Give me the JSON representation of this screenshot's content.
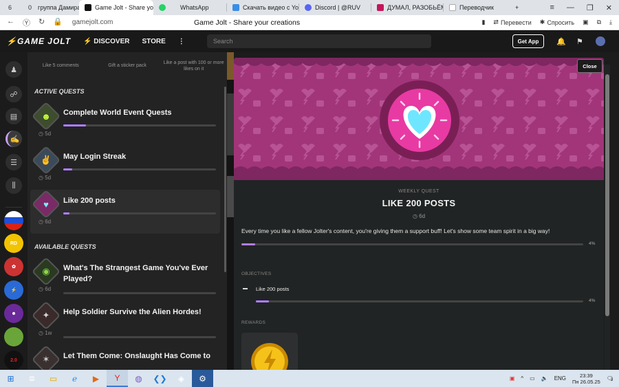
{
  "browser": {
    "tabs": [
      {
        "label": "6",
        "kind": "counter"
      },
      {
        "label": "группа Дамира",
        "badge": "0",
        "color": "#4a7cff"
      },
      {
        "label": "Game Jolt - Share yo",
        "active": true,
        "color": "#111111"
      },
      {
        "label": "WhatsApp",
        "color": "#25d366"
      },
      {
        "label": "Скачать видео с YouTu",
        "color": "#3a8ee6"
      },
      {
        "label": "Discord | @RUV",
        "color": "#5865f2"
      },
      {
        "label": "ДУМАЛ, РАЗОБЬЁМС",
        "color": "#c2185b"
      },
      {
        "label": "Переводчик",
        "color": "#e0e0e0"
      }
    ],
    "new_tab": "+",
    "address": "gamejolt.com",
    "page_title": "Game Jolt - Share your creations",
    "translate_label": "Перевести",
    "ask_label": "Спросить"
  },
  "gamejolt": {
    "logo": "GAME JOLT",
    "nav_discover": "DISCOVER",
    "nav_store": "STORE",
    "search_placeholder": "Search",
    "get_app": "Get App"
  },
  "quests_panel": {
    "previous_tasks": [
      "Like 5 comments",
      "Gift a sticker pack",
      "Like a post with 100 or more likes on it"
    ],
    "active_heading": "ACTIVE QUESTS",
    "active": [
      {
        "title": "Complete World Event Quests",
        "time": "5d",
        "progress": 0.15,
        "color": "#3d4d2e",
        "glyph": "☻",
        "glyph_color": "#c8ff3a"
      },
      {
        "title": "May Login Streak",
        "time": "5d",
        "progress": 0.06,
        "color": "#3a4a5a",
        "glyph": "✌",
        "glyph_color": "#4ad7ff"
      },
      {
        "title": "Like 200 posts",
        "time": "6d",
        "progress": 0.04,
        "color": "#7a2a66",
        "glyph": "♥",
        "glyph_color": "#7fe8ff",
        "selected": true
      }
    ],
    "available_heading": "AVAILABLE QUESTS",
    "available": [
      {
        "title": "What's The Strangest Game You've Ever Played?",
        "time": "6d",
        "progress": 0,
        "color": "#2a3a20",
        "glyph": "◉",
        "glyph_color": "#8bd84a"
      },
      {
        "title": "Help Soldier Survive the Alien Hordes!",
        "time": "1w",
        "progress": 0,
        "color": "#3a2a2a",
        "glyph": "✦",
        "glyph_color": "#d0d0d0"
      },
      {
        "title": "Let Them Come: Onslaught Has Come to",
        "time": "",
        "progress": 0,
        "color": "#3a3030",
        "glyph": "✶",
        "glyph_color": "#cccccc"
      }
    ]
  },
  "quest_modal": {
    "close_label": "Close",
    "kind": "WEEKLY QUEST",
    "title": "LIKE 200 POSTS",
    "time": "6d",
    "description": "Every time you like a fellow Jolter's content, you're giving them a support buff! Let's show some team spirit in a big way!",
    "progress": 0.04,
    "progress_label": "4%",
    "objectives_heading": "OBJECTIVES",
    "objectives": [
      {
        "label": "Like 200 posts",
        "progress": 0.04,
        "progress_label": "4%"
      }
    ],
    "rewards_heading": "REWARDS",
    "banner_color": "#a2357a",
    "heart_color": "#6fe6ff"
  },
  "taskbar": {
    "language": "ENG",
    "time": "23:39",
    "date": "Пн 26.05.25",
    "notification_count": "3"
  }
}
